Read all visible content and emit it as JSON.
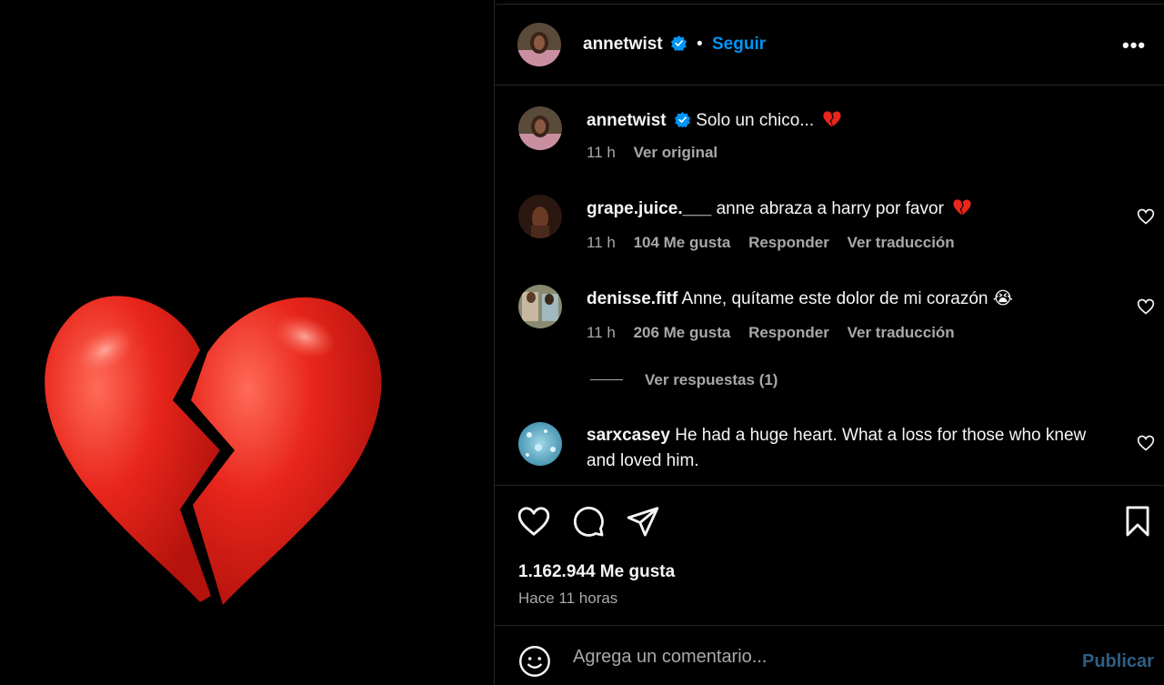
{
  "post": {
    "username": "annetwist",
    "follow_label": "Seguir",
    "dot": "•",
    "more_label": "•••"
  },
  "caption": {
    "username": "annetwist",
    "text": "Solo un chico...",
    "time": "11 h",
    "see_original": "Ver original"
  },
  "comments": [
    {
      "username": "grape.juice.___",
      "text": "anne abraza a harry por favor",
      "time": "11 h",
      "likes": "104 Me gusta",
      "reply": "Responder",
      "translate": "Ver traducción"
    },
    {
      "username": "denisse.fitf",
      "text": "Anne, quítame este dolor de mi corazón 😭",
      "time": "11 h",
      "likes": "206 Me gusta",
      "reply": "Responder",
      "translate": "Ver traducción"
    },
    {
      "username": "sarxcasey",
      "text": "He had a huge heart. What a loss for those who knew and loved him."
    }
  ],
  "view_replies": "Ver respuestas (1)",
  "likes_count": "1.162.944 Me gusta",
  "time_ago": "Hace 11 horas",
  "add_comment": {
    "placeholder": "Agrega un comentario...",
    "publish": "Publicar"
  },
  "colors": {
    "accent": "#0095f6",
    "publish_disabled": "#2d5e85",
    "heart_red": "#e8261c",
    "muted": "#a8a8a8"
  },
  "icons": [
    "broken-heart-emoji",
    "verified-badge-icon",
    "more-options-icon",
    "heart-outline-icon",
    "comment-icon",
    "share-icon",
    "bookmark-icon",
    "emoji-smiley-icon"
  ]
}
